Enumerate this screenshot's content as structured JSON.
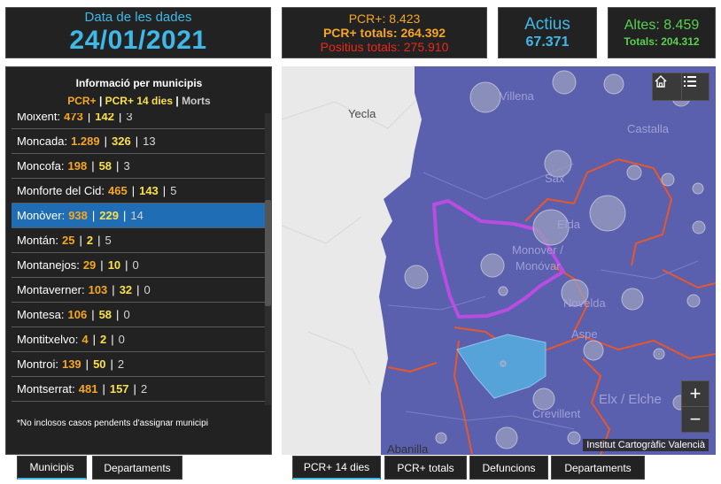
{
  "header": {
    "date_label": "Data de les dades",
    "date_value": "24/01/2021",
    "pcr_line1": "PCR+: 8.423",
    "pcr_line2": "PCR+ totals: 264.392",
    "pcr_line3": "Positius totals: 275.910",
    "actius_label": "Actius",
    "actius_value": "67.371",
    "altes_line1": "Altes: 8.459",
    "altes_line2": "Totals: 204.312"
  },
  "municipis": {
    "title": "Informació per municipis",
    "legend": {
      "pcr": "PCR+",
      "sep": "|",
      "pcr14": "PCR+ 14 dies",
      "morts": "Morts"
    },
    "rows": [
      {
        "name": "Moixent:",
        "pcr": "473",
        "pcr14": "142",
        "morts": "3"
      },
      {
        "name": "Moncada:",
        "pcr": "1.289",
        "pcr14": "326",
        "morts": "13"
      },
      {
        "name": "Moncofa:",
        "pcr": "198",
        "pcr14": "58",
        "morts": "3"
      },
      {
        "name": "Monforte del Cid:",
        "pcr": "465",
        "pcr14": "143",
        "morts": "5"
      },
      {
        "name": "Monòver:",
        "pcr": "938",
        "pcr14": "229",
        "morts": "14"
      },
      {
        "name": "Montán:",
        "pcr": "25",
        "pcr14": "2",
        "morts": "5"
      },
      {
        "name": "Montanejos:",
        "pcr": "29",
        "pcr14": "10",
        "morts": "0"
      },
      {
        "name": "Montaverner:",
        "pcr": "103",
        "pcr14": "32",
        "morts": "0"
      },
      {
        "name": "Montesa:",
        "pcr": "106",
        "pcr14": "58",
        "morts": "0"
      },
      {
        "name": "Montitxelvo:",
        "pcr": "4",
        "pcr14": "2",
        "morts": "0"
      },
      {
        "name": "Montroi:",
        "pcr": "139",
        "pcr14": "50",
        "morts": "2"
      },
      {
        "name": "Montserrat:",
        "pcr": "481",
        "pcr14": "157",
        "morts": "2"
      }
    ],
    "selected": "Monòver:",
    "note": "*No inclosos casos pendents d'assignar municipi"
  },
  "tabs_left": {
    "municipis": "Municipis",
    "departaments": "Departaments"
  },
  "tabs_right": {
    "pcr14": "PCR+ 14 dies",
    "pcr_totals": "PCR+ totals",
    "defuncions": "Defuncions",
    "departaments": "Departaments"
  },
  "map": {
    "labels": {
      "villena": "Villena",
      "yecla": "Yecla",
      "castalla": "Castalla",
      "sax": "Sax",
      "elda": "Elda",
      "monover": "Monover /",
      "monovar": "Monóvar",
      "novelda": "Novelda",
      "aspe": "Aspe",
      "elx": "Elx / Elche",
      "crevillent": "Crevillent",
      "abanilla": "Abanilla"
    },
    "home_icon": "home-icon",
    "list_icon": "list-icon",
    "zoom_in": "+",
    "zoom_out": "−",
    "attribution": "Institut Cartogràfic Valencià",
    "colors": {
      "region": "#5a5fae",
      "boundary": "#e8572a",
      "selected_outline": "#b84de0",
      "highlight": "#56a3d9",
      "base": "#e9e9e9"
    }
  }
}
